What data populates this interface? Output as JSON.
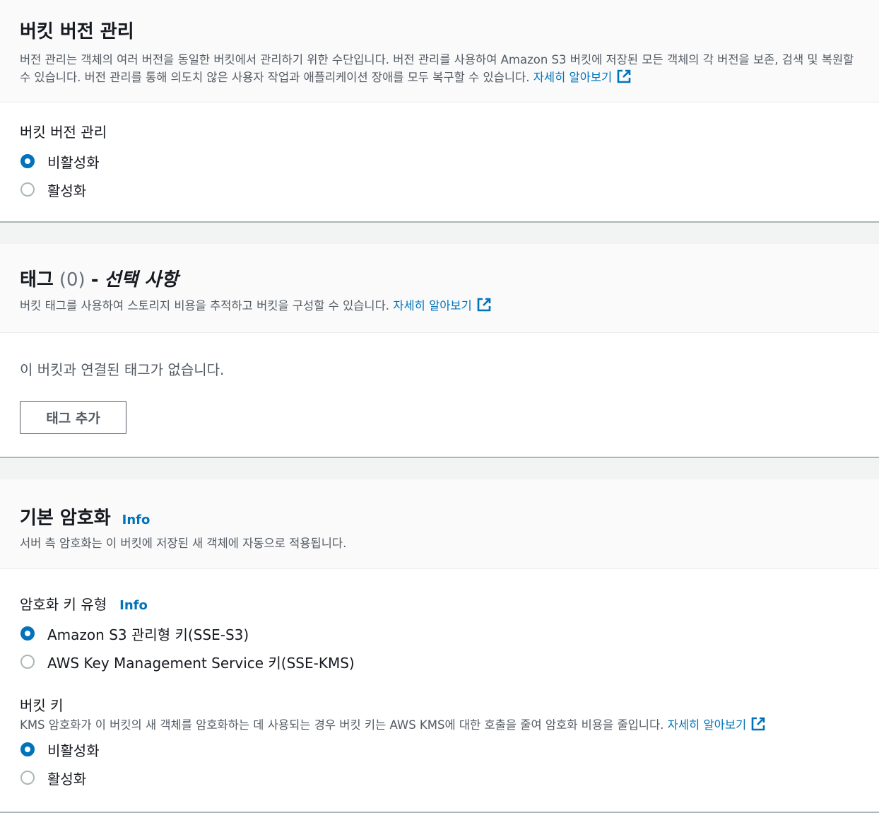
{
  "versioning": {
    "title": "버킷 버전 관리",
    "description": "버전 관리는 객체의 여러 버전을 동일한 버킷에서 관리하기 위한 수단입니다. 버전 관리를 사용하여 Amazon S3 버킷에 저장된 모든 객체의 각 버전을 보존, 검색 및 복원할 수 있습니다. 버전 관리를 통해 의도치 않은 사용자 작업과 애플리케이션 장애를 모두 복구할 수 있습니다.",
    "learn_more": "자세히 알아보기",
    "field_label": "버킷 버전 관리",
    "options": [
      "비활성화",
      "활성화"
    ],
    "selected": "비활성화"
  },
  "tags": {
    "title": "태그",
    "count": "(0)",
    "dash": "-",
    "optional": "선택 사항",
    "description": "버킷 태그를 사용하여 스토리지 비용을 추적하고 버킷을 구성할 수 있습니다.",
    "learn_more": "자세히 알아보기",
    "empty_text": "이 버킷과 연결된 태그가 없습니다.",
    "add_button": "태그 추가"
  },
  "encryption": {
    "title": "기본 암호화",
    "info": "Info",
    "description": "서버 측 암호화는 이 버킷에 저장된 새 객체에 자동으로 적용됩니다.",
    "key_type_label": "암호화 키 유형",
    "key_type_info": "Info",
    "key_type_options": [
      "Amazon S3 관리형 키(SSE-S3)",
      "AWS Key Management Service 키(SSE-KMS)"
    ],
    "key_type_selected": "Amazon S3 관리형 키(SSE-S3)",
    "bucket_key_label": "버킷 키",
    "bucket_key_description": "KMS 암호화가 이 버킷의 새 객체를 암호화하는 데 사용되는 경우 버킷 키는 AWS KMS에 대한 호출을 줄여 암호화 비용을 줄입니다.",
    "learn_more": "자세히 알아보기",
    "bucket_key_options": [
      "비활성화",
      "활성화"
    ],
    "bucket_key_selected": "비활성화"
  },
  "colors": {
    "accent": "#0073bb",
    "text": "#16191f",
    "secondary_text": "#545b64",
    "page_bg": "#f2f3f3"
  }
}
